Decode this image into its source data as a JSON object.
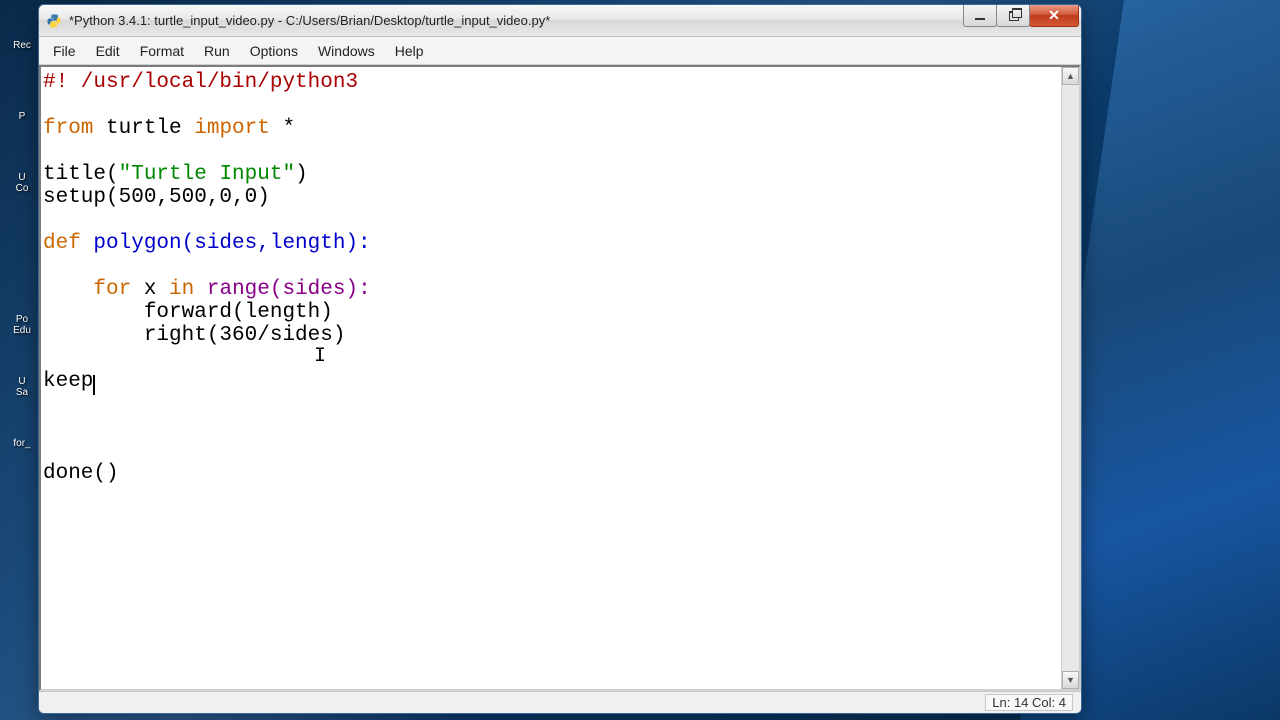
{
  "window": {
    "title": "*Python 3.4.1: turtle_input_video.py - C:/Users/Brian/Desktop/turtle_input_video.py*"
  },
  "menubar": {
    "items": [
      "File",
      "Edit",
      "Format",
      "Run",
      "Options",
      "Windows",
      "Help"
    ]
  },
  "code": {
    "line1a": "#! /usr/local/bin/python3",
    "line3_from": "from",
    "line3_turtle": " turtle ",
    "line3_import": "import",
    "line3_star": " *",
    "line5_pre": "title(",
    "line5_str": "\"Turtle Input\"",
    "line5_post": ")",
    "line6": "setup(500,500,0,0)",
    "line8_def": "def",
    "line8_name": " polygon(sides,length):",
    "line10_indent": "    ",
    "line10_for": "for",
    "line10_x": " x ",
    "line10_in": "in",
    "line10_range": " range(sides):",
    "line11": "        forward(length)",
    "line12": "        right(360/sides)",
    "line14": "keep",
    "line18": "done()"
  },
  "status": {
    "ln_label": "Ln: ",
    "ln_val": "14",
    "col_label": "Col: ",
    "col_val": "4"
  },
  "desktop_icons": {
    "i1": "Rec",
    "i2": "P",
    "i3": "U\nCo",
    "i4": "Po\nEdu",
    "i5": "U\nSa",
    "i6": "for_"
  }
}
